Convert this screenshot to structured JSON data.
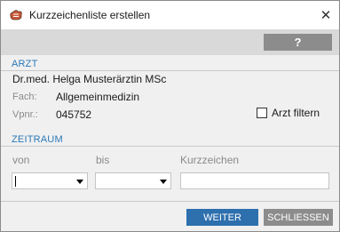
{
  "window": {
    "title": "Kurzzeichenliste erstellen",
    "close_glyph": "✕"
  },
  "toolbar": {
    "help_label": "?"
  },
  "arzt": {
    "section_label": "ARZT",
    "name": "Dr.med. Helga Musterärztin MSc",
    "fach_label": "Fach:",
    "fach_value": "Allgemeinmedizin",
    "vpnr_label": "Vpnr.:",
    "vpnr_value": "045752",
    "filter_label": "Arzt filtern",
    "filter_checked": false
  },
  "zeitraum": {
    "section_label": "ZEITRAUM",
    "von_label": "von",
    "bis_label": "bis",
    "kurzzeichen_label": "Kurzzeichen",
    "von_value": "",
    "bis_value": "",
    "kurzzeichen_value": ""
  },
  "footer": {
    "weiter_label": "WEITER",
    "schliessen_label": "SCHLIESSEN"
  },
  "colors": {
    "accent": "#2a78b8",
    "primary_button": "#2e6fae",
    "secondary_button": "#8c8c8c"
  },
  "icons": {
    "app": "hand-icon",
    "close": "close-icon",
    "dropdown": "chevron-down-icon"
  }
}
